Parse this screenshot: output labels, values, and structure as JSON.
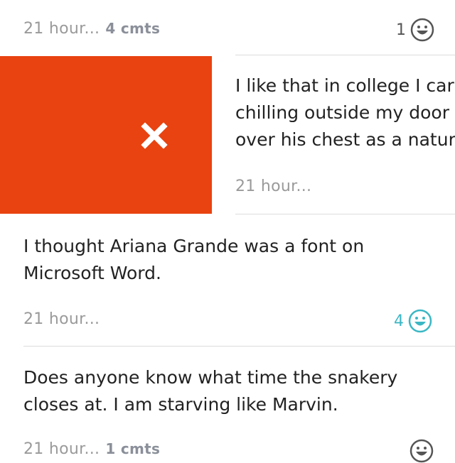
{
  "post_top": {
    "time": "21 hour...",
    "comments": "4 cmts",
    "votes": "1"
  },
  "post_swiped": {
    "lines": [
      "I like that in college I car",
      "chilling outside my door",
      "over his chest as a natura"
    ],
    "time": "21 hour..."
  },
  "post_ariana": {
    "lines": [
      "I thought Ariana Grande was a font on",
      "Microsoft Word."
    ],
    "time": "21 hour...",
    "votes": "4"
  },
  "post_snakery": {
    "lines": [
      "Does anyone know what time the snakery",
      "closes at. I am starving like Marvin."
    ],
    "time": "21 hour...",
    "comments": "1 cmts"
  },
  "colors": {
    "accent": "#3bb7c4",
    "swipe_red": "#e84310",
    "muted": "#9a9a9a",
    "icon_dark": "#555555"
  },
  "icons": {
    "vote": "smiley-face-icon",
    "delete": "close-icon"
  }
}
